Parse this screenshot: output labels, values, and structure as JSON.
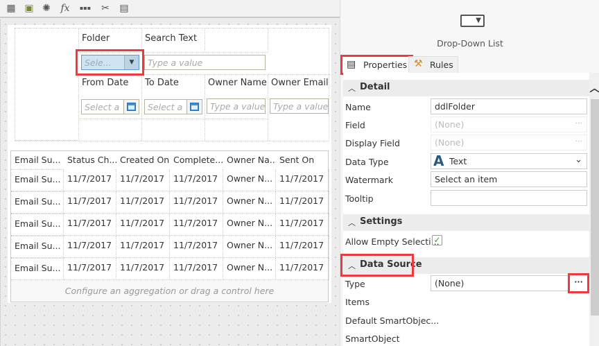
{
  "toolbar": {
    "icons": [
      "form-layout-icon",
      "image-icon",
      "gear-icon",
      "function-icon",
      "more-icon",
      "tools-icon",
      "properties-icon"
    ],
    "fx": "fx",
    "more": "▪▪▪"
  },
  "filters": {
    "folder_label": "Folder",
    "folder_placeholder": "Sele...",
    "search_label": "Search Text",
    "search_placeholder": "Type a value",
    "from_label": "From Date",
    "from_placeholder": "Select a",
    "to_label": "To Date",
    "to_placeholder": "Select a",
    "owner_name_label": "Owner Name",
    "owner_name_placeholder": "Type a value",
    "owner_email_label": "Owner Email",
    "owner_email_placeholder": "Type a value"
  },
  "grid": {
    "columns": [
      "Email Su...",
      "Status Ch...",
      "Created On",
      "Complete...",
      "Owner Na...",
      "Sent On"
    ],
    "rows": [
      [
        "Email Su...",
        "11/7/2017",
        "11/7/2017",
        "11/7/2017",
        "Owner N...",
        "11/7/2017"
      ],
      [
        "Email Su...",
        "11/7/2017",
        "11/7/2017",
        "11/7/2017",
        "Owner N...",
        "11/7/2017"
      ],
      [
        "Email Su...",
        "11/7/2017",
        "11/7/2017",
        "11/7/2017",
        "Owner N...",
        "11/7/2017"
      ],
      [
        "Email Su...",
        "11/7/2017",
        "11/7/2017",
        "11/7/2017",
        "Owner N...",
        "11/7/2017"
      ],
      [
        "Email Su...",
        "11/7/2017",
        "11/7/2017",
        "11/7/2017",
        "Owner N...",
        "11/7/2017"
      ]
    ],
    "footer": "Configure an aggregation or drag a control here"
  },
  "panel": {
    "control_name": "Drop-Down List",
    "tabs": {
      "properties": "Properties",
      "rules": "Rules"
    },
    "detail": {
      "title": "Detail",
      "name_label": "Name",
      "name_value": "ddlFolder",
      "field_label": "Field",
      "field_value": "(None)",
      "display_label": "Display Field",
      "display_value": "(None)",
      "datatype_label": "Data Type",
      "datatype_value": "Text",
      "datatype_glyph": "A",
      "watermark_label": "Watermark",
      "watermark_value": "Select an item",
      "tooltip_label": "Tooltip",
      "tooltip_value": ""
    },
    "settings": {
      "title": "Settings",
      "allow_empty_label": "Allow Empty Selecti...",
      "allow_empty_checked": true
    },
    "datasource": {
      "title": "Data Source",
      "type_label": "Type",
      "type_value": "(None)",
      "items_label": "Items",
      "default_label": "Default SmartObjec...",
      "smartobject_label": "SmartObject"
    },
    "dots": "···"
  },
  "colors": {
    "highlight": "#f0393f",
    "accent": "#3b8fd9"
  }
}
